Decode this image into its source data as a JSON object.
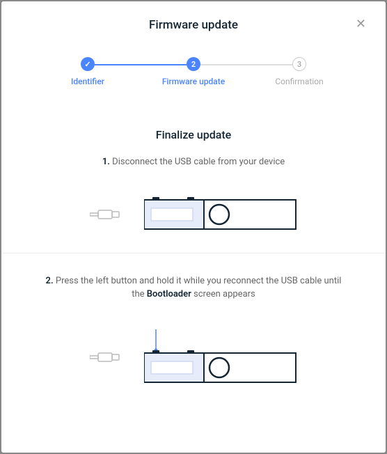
{
  "header": {
    "title": "Firmware update"
  },
  "stepper": {
    "steps": [
      {
        "label": "Identifier",
        "marker": "✓"
      },
      {
        "label": "Firmware update",
        "marker": "2"
      },
      {
        "label": "Confirmation",
        "marker": "3"
      }
    ]
  },
  "content": {
    "subtitle": "Finalize update",
    "step1": {
      "number": "1.",
      "text": "Disconnect the USB cable from your device"
    },
    "step2": {
      "number": "2.",
      "text_before": "Press the left button and hold it while you reconnect the USB cable until the ",
      "bold": "Bootloader",
      "text_after": " screen appears"
    }
  }
}
